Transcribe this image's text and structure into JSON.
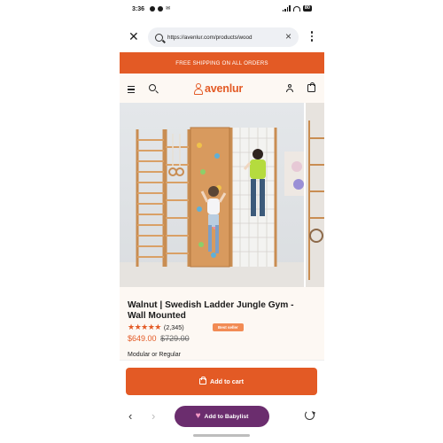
{
  "status_bar": {
    "time": "3:36",
    "battery": "80"
  },
  "browser": {
    "url": "https://avenlur.com/products/wood"
  },
  "banner": {
    "text": "FREE SHIPPING ON ALL ORDERS"
  },
  "header": {
    "logo_text": "avenlur"
  },
  "product": {
    "title": "Walnut | Swedish Ladder Jungle Gym - Wall Mounted",
    "stars": "★★★★★",
    "rating_count": "(2,345)",
    "badge": "Best seller",
    "price": "$649.00",
    "compare_price": "$729.00",
    "variant_label": "Modular or Regular"
  },
  "actions": {
    "add_to_cart": "Add to cart",
    "babylist": "Add to Babylist"
  },
  "icons": {
    "close": "close-icon",
    "search": "search-icon",
    "menu": "hamburger-icon",
    "account": "user-icon",
    "cart": "bag-icon",
    "back": "chevron-left-icon",
    "forward": "chevron-right-icon",
    "reload": "reload-icon"
  },
  "colors": {
    "brand_orange": "#e35a25",
    "babylist_purple": "#6b2d6e",
    "header_bg": "#fdf8f3"
  }
}
